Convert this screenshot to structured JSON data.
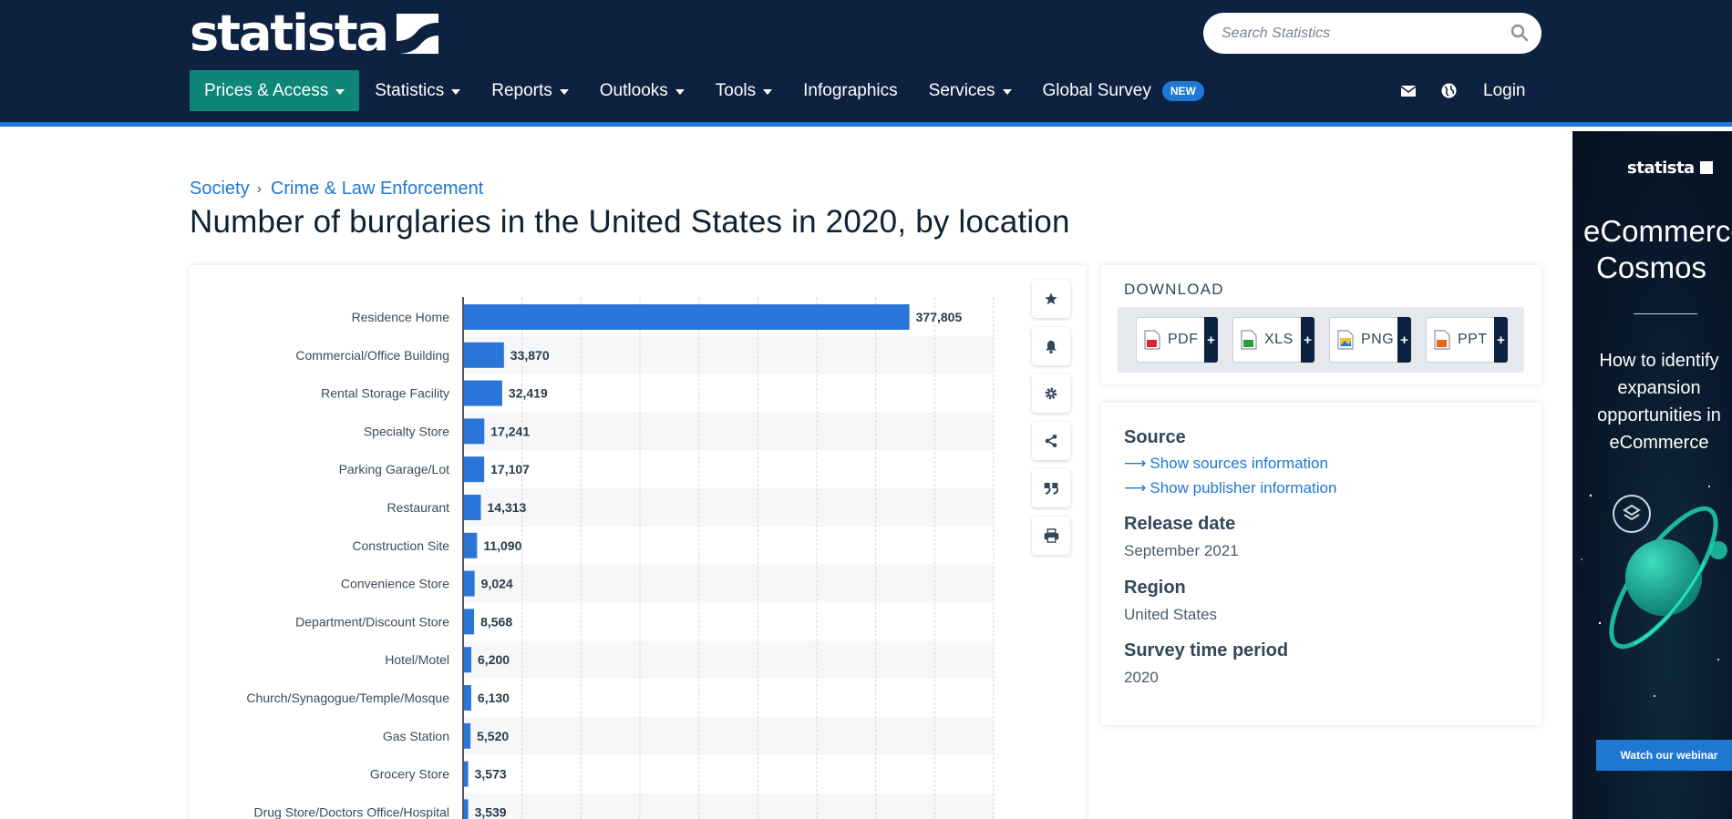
{
  "header": {
    "logo_text": "statista",
    "search_placeholder": "Search Statistics",
    "nav": [
      {
        "label": "Prices & Access",
        "dropdown": true,
        "active": true
      },
      {
        "label": "Statistics",
        "dropdown": true
      },
      {
        "label": "Reports",
        "dropdown": true
      },
      {
        "label": "Outlooks",
        "dropdown": true
      },
      {
        "label": "Tools",
        "dropdown": true
      },
      {
        "label": "Infographics",
        "dropdown": false
      },
      {
        "label": "Services",
        "dropdown": true
      },
      {
        "label": "Global Survey",
        "dropdown": false,
        "badge": "NEW"
      }
    ],
    "login_label": "Login",
    "colors": {
      "header_bg": "#0d2240",
      "accent": "#1f78d1",
      "active_nav": "#0d8577"
    }
  },
  "breadcrumb": {
    "items": [
      "Society",
      "Crime & Law Enforcement"
    ],
    "separator": "›"
  },
  "page_title": "Number of burglaries in the United States in 2020, by location",
  "chart_tools": [
    "star-icon",
    "bell-icon",
    "gear-icon",
    "share-icon",
    "quote-icon",
    "print-icon"
  ],
  "chart_data": {
    "type": "bar",
    "orientation": "horizontal",
    "title": "",
    "xlabel": "",
    "ylabel": "",
    "bar_color": "#2c75d8",
    "grid": true,
    "xlim": [
      0,
      450000
    ],
    "categories": [
      "Residence Home",
      "Commercial/Office Building",
      "Rental Storage Facility",
      "Specialty Store",
      "Parking Garage/Lot",
      "Restaurant",
      "Construction Site",
      "Convenience Store",
      "Department/Discount Store",
      "Hotel/Motel",
      "Church/Synagogue/Temple/Mosque",
      "Gas Station",
      "Grocery Store",
      "Drug Store/Doctors Office/Hospital"
    ],
    "values": [
      377805,
      33870,
      32419,
      17241,
      17107,
      14313,
      11090,
      9024,
      8568,
      6200,
      6130,
      5520,
      3573,
      3539
    ],
    "value_labels": [
      "377,805",
      "33,870",
      "32,419",
      "17,241",
      "17,107",
      "14,313",
      "11,090",
      "9,024",
      "8,568",
      "6,200",
      "6,130",
      "5,520",
      "3,573",
      "3,539"
    ]
  },
  "download": {
    "heading": "DOWNLOAD",
    "buttons": [
      {
        "label": "PDF",
        "icon": "pdf-file-icon",
        "color": "#d9262c"
      },
      {
        "label": "XLS",
        "icon": "xls-file-icon",
        "color": "#2e9b3b"
      },
      {
        "label": "PNG",
        "icon": "png-file-icon",
        "color": "#1f78d1"
      },
      {
        "label": "PPT",
        "icon": "ppt-file-icon",
        "color": "#e6661a"
      }
    ],
    "plus": "+"
  },
  "info": {
    "source_label": "Source",
    "source_link": "Show sources information",
    "publisher_link": "Show publisher information",
    "release_label": "Release date",
    "release_value": "September 2021",
    "region_label": "Region",
    "region_value": "United States",
    "period_label": "Survey time period",
    "period_value": "2020"
  },
  "ad": {
    "logo": "statista",
    "title_line1": "eCommerce",
    "title_line2": "Cosmos",
    "subtitle": "How to identify expansion opportunities in eCommerce",
    "button": "Watch our webinar"
  }
}
